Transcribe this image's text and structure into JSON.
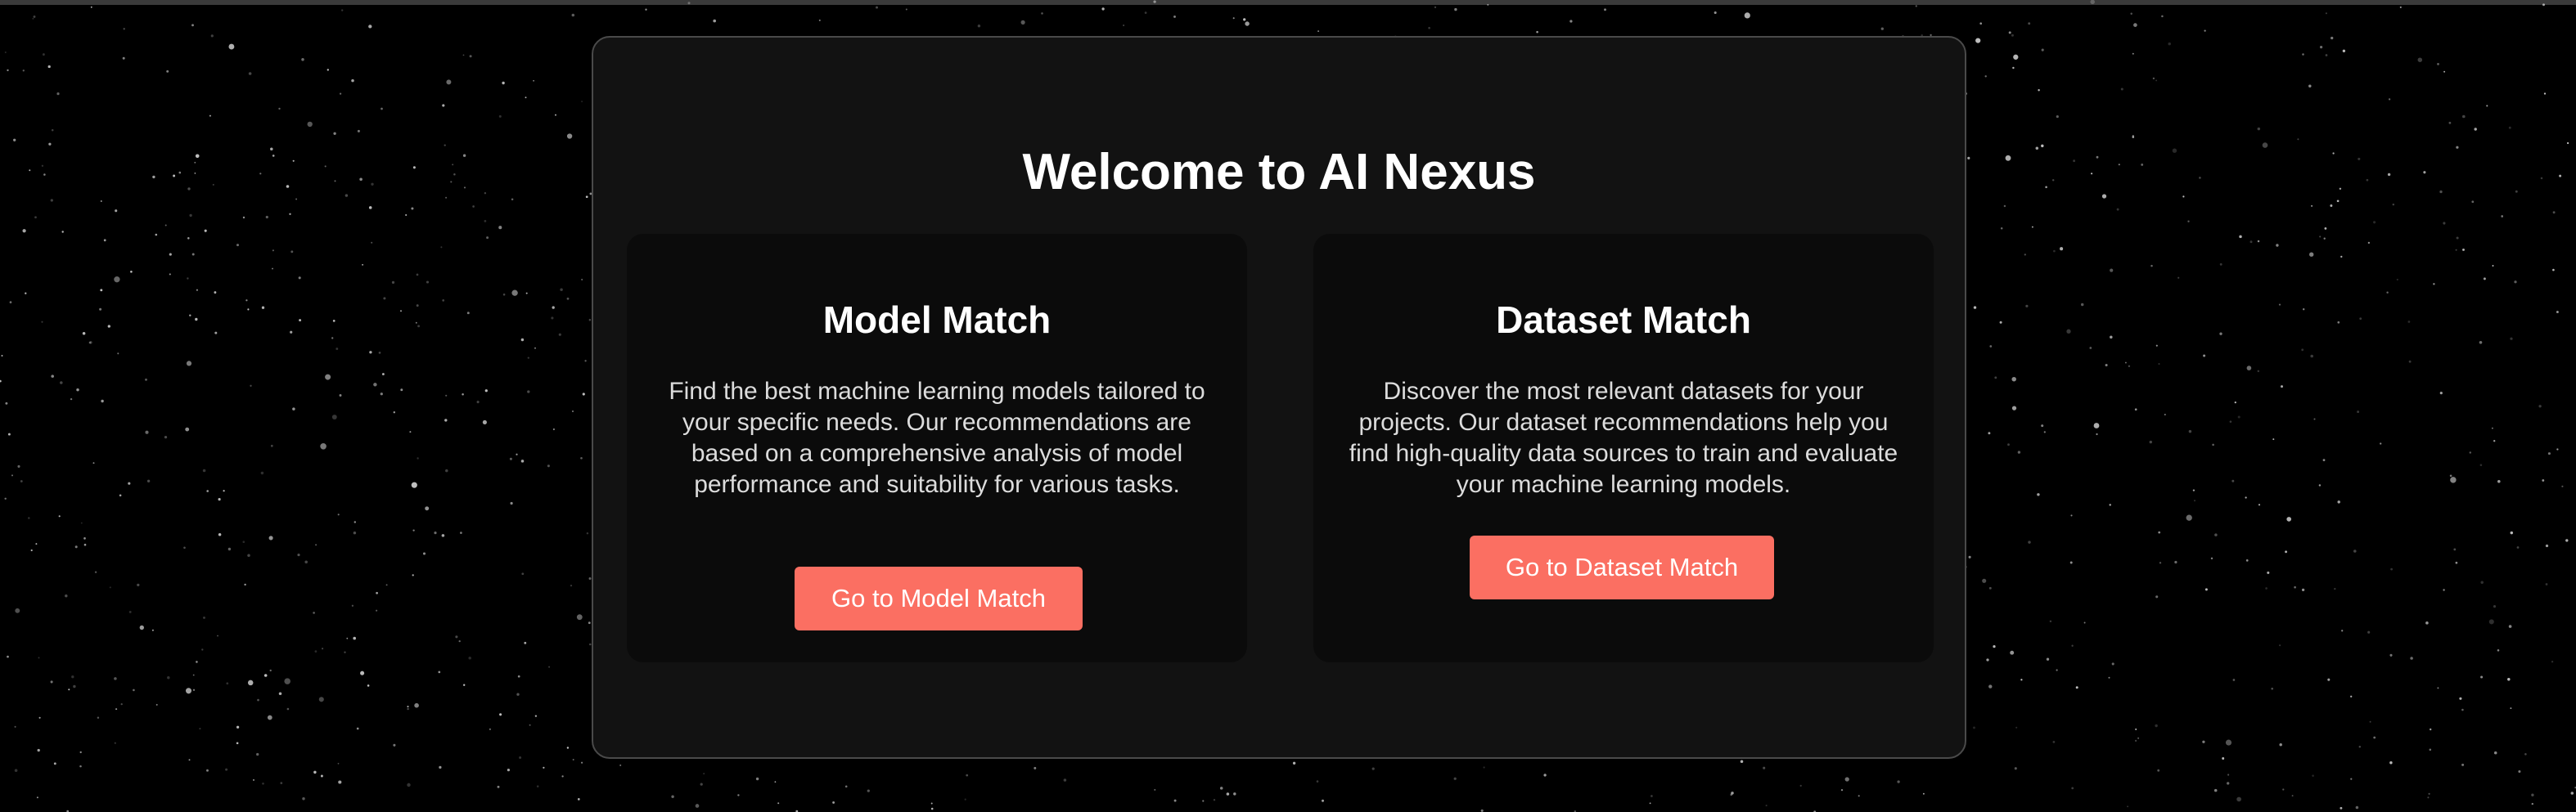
{
  "page": {
    "title": "Welcome to AI Nexus"
  },
  "cards": {
    "model": {
      "title": "Model Match",
      "description": "Find the best machine learning models tailored to your specific needs. Our recommendations are based on a comprehensive analysis of model performance and suitability for various tasks.",
      "button_label": "Go to Model Match"
    },
    "dataset": {
      "title": "Dataset Match",
      "description": "Discover the most relevant datasets for your projects. Our dataset recommendations help you find high-quality data sources to train and evaluate your machine learning models.",
      "button_label": "Go to Dataset Match"
    }
  },
  "colors": {
    "background": "#000000",
    "panel": "#121212",
    "card": "#0b0b0b",
    "accent": "#fb6f62",
    "text": "#ffffff"
  }
}
